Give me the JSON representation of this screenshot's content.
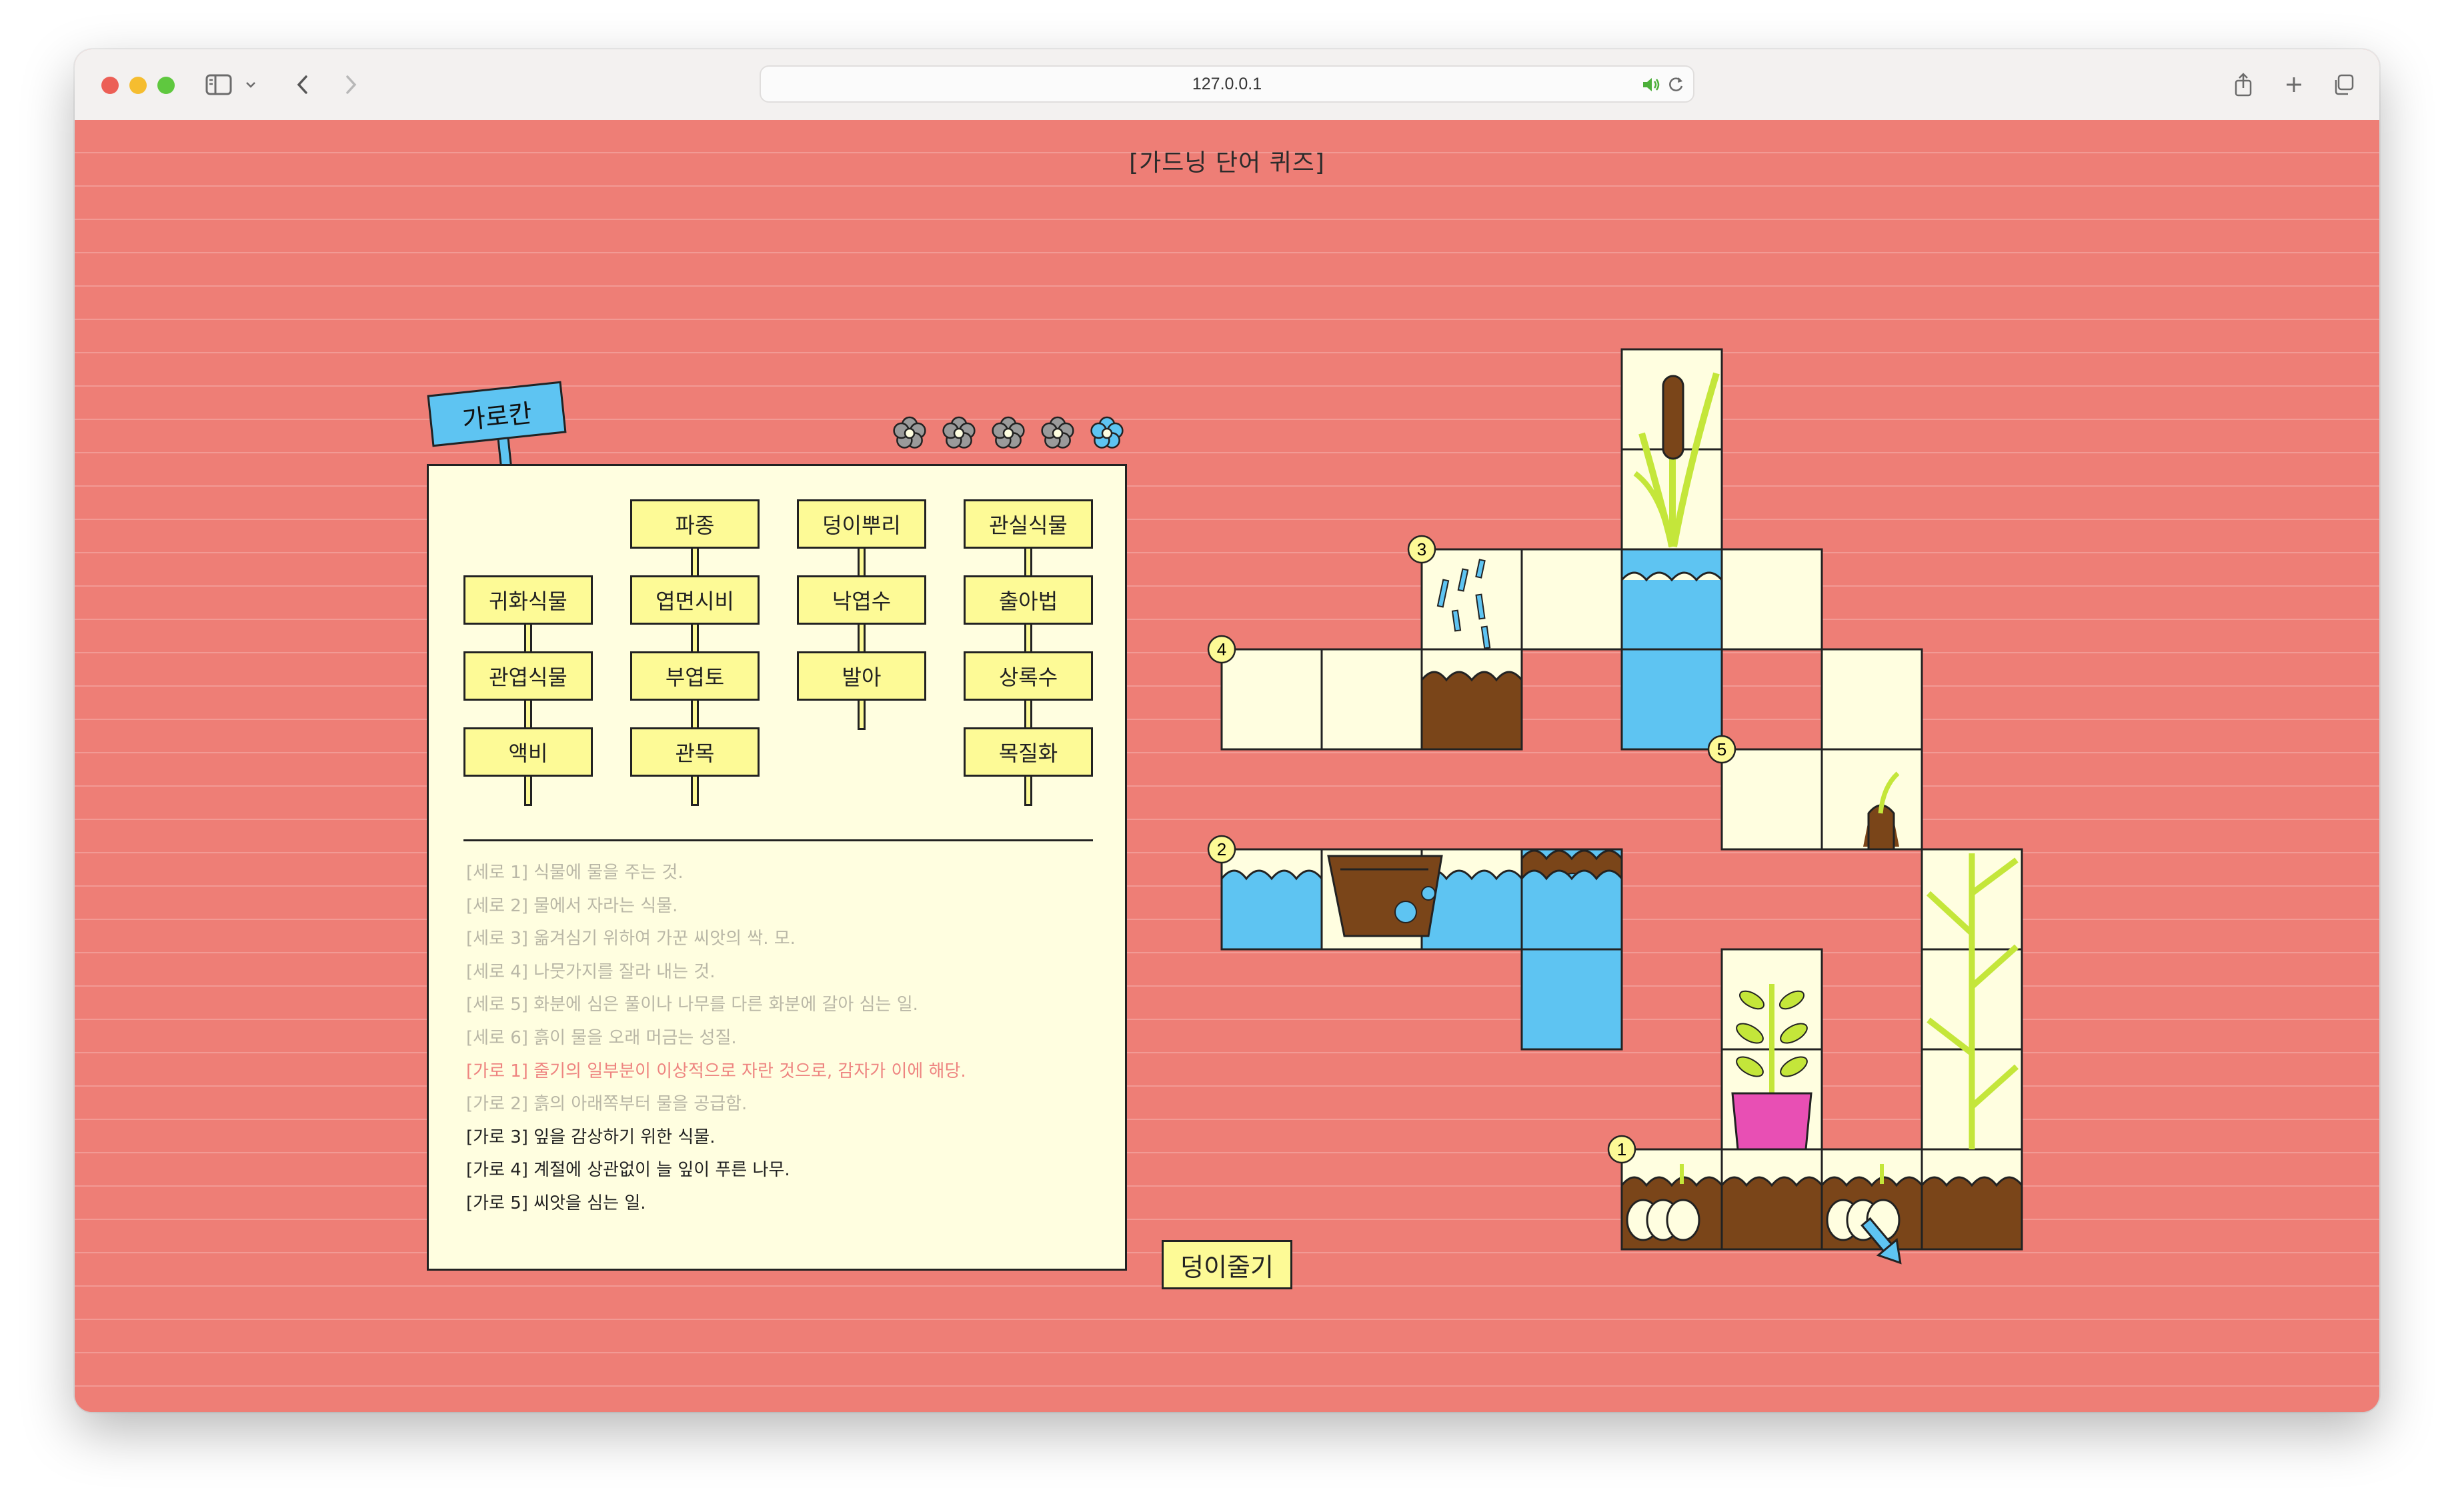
{
  "browser": {
    "url": "127.0.0.1"
  },
  "page": {
    "title": "[가드닝 단어 퀴즈]"
  },
  "sign": {
    "label": "가로칸"
  },
  "progress": {
    "total": 5,
    "highlighted_index": 5,
    "icon": "flower-icon",
    "colors": {
      "inactive": "#9a9a9a",
      "active": "#5ec4f2"
    }
  },
  "word_cards": {
    "columns": [
      {
        "words": [
          "귀화식물",
          "관엽식물",
          "액비"
        ]
      },
      {
        "words": [
          "파종",
          "엽면시비",
          "부엽토",
          "관목"
        ]
      },
      {
        "words": [
          "덩이뿌리",
          "낙엽수",
          "발아"
        ]
      },
      {
        "words": [
          "관실식물",
          "출아법",
          "상록수",
          "목질화"
        ]
      }
    ]
  },
  "clues": [
    {
      "text": "[세로 1] 식물에 물을 주는 것.",
      "state": "faded"
    },
    {
      "text": "[세로 2] 물에서 자라는 식물.",
      "state": "faded"
    },
    {
      "text": "[세로 3] 옮겨심기 위하여 가꾼 씨앗의 싹. 모.",
      "state": "faded"
    },
    {
      "text": "[세로 4] 나뭇가지를 잘라 내는 것.",
      "state": "faded"
    },
    {
      "text": "[세로 5] 화분에 심은 풀이나 나무를 다른 화분에 갈아 심는 일.",
      "state": "faded"
    },
    {
      "text": "[세로 6] 흙이 물을 오래 머금는 성질.",
      "state": "faded"
    },
    {
      "text": "[가로 1] 줄기의 일부분이 이상적으로 자란 것으로, 감자가 이에 해당.",
      "state": "active"
    },
    {
      "text": "[가로 2] 흙의 아래쪽부터 물을 공급함.",
      "state": "faded"
    },
    {
      "text": "[가로 3] 잎을 감상하기 위한 식물.",
      "state": "normal"
    },
    {
      "text": "[가로 4] 계절에 상관없이 늘 잎이 푸른 나무.",
      "state": "normal"
    },
    {
      "text": "[가로 5] 씨앗을 심는 일.",
      "state": "normal"
    }
  ],
  "clue_colors": {
    "faded": "#b9b7a6",
    "active": "#ee8480",
    "normal": "#222222"
  },
  "answer_button": {
    "label": "덩이줄기"
  },
  "crossword": {
    "markers": [
      "1",
      "2",
      "3",
      "4",
      "5"
    ]
  },
  "colors": {
    "background": "#ee7e76",
    "panel": "#fffee0",
    "card": "#fdfa96",
    "water": "#5ec4f2",
    "soil": "#7a4519",
    "leaf": "#c4e63a",
    "pot": "#e84fb4"
  }
}
